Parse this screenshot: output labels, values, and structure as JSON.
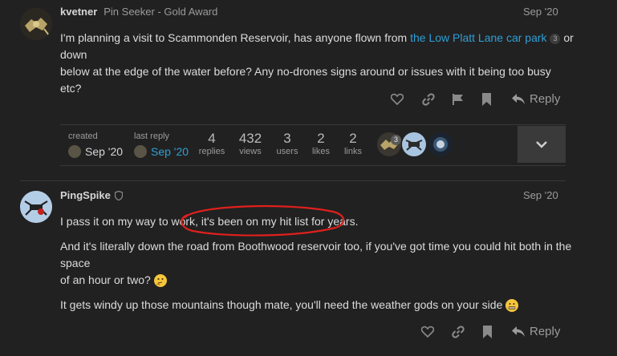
{
  "post1": {
    "username": "kvetner",
    "user_title": "Pin Seeker - Gold Award",
    "date": "Sep '20",
    "text_before_link": "I'm planning a visit to Scammonden Reservoir, has anyone flown from ",
    "link_text": "the Low Platt Lane car park",
    "link_count": "3",
    "text_after_link": " or down",
    "text_line2": "below at the edge of the water before? Any no-drones signs around or issues with it being too busy etc?",
    "reply_label": "Reply"
  },
  "topic_map": {
    "created_label": "created",
    "created_date": "Sep '20",
    "last_reply_label": "last reply",
    "last_reply_date": "Sep '20",
    "stats": [
      {
        "num": "4",
        "label": "replies"
      },
      {
        "num": "432",
        "label": "views"
      },
      {
        "num": "3",
        "label": "users"
      },
      {
        "num": "2",
        "label": "likes"
      },
      {
        "num": "2",
        "label": "links"
      }
    ],
    "participant_badge": "3"
  },
  "post2": {
    "username": "PingSpike",
    "date": "Sep '20",
    "para1_a": "I pass it on my way to work",
    "para1_b": ", it's been on my hit list for years.",
    "para2_line1": "And it's literally down the road from Boothwood reservoir too, if you've got time you could hit both in the space",
    "para2_line2": "of an hour or two? ",
    "para3": "It gets windy up those mountains though mate, you'll need the weather gods on your side ",
    "reply_label": "Reply"
  },
  "colors": {
    "background": "#212121",
    "link": "#2e9fd6",
    "annotation_red": "#e0201c"
  }
}
